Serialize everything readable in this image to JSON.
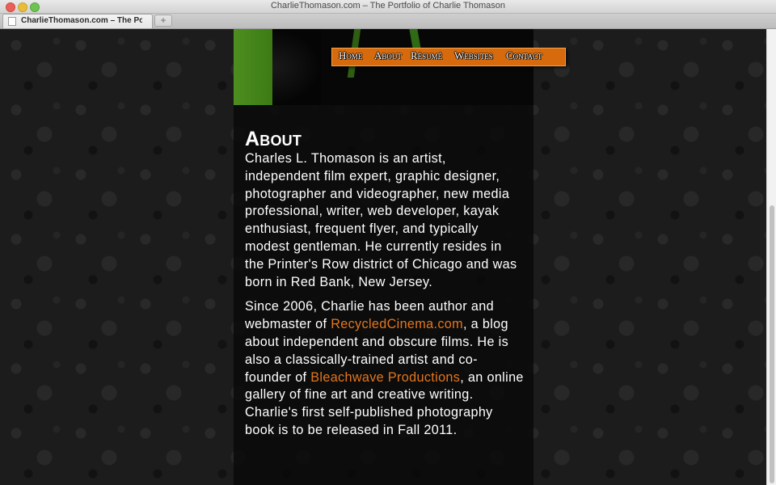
{
  "window": {
    "title": "CharlieThomason.com – The Portfolio of Charlie Thomason",
    "tab_label": "CharlieThomason.com – The Po…",
    "new_tab": "+"
  },
  "nav": {
    "home": "Home",
    "about": "About",
    "resume": "Résumé",
    "websites": "Websites",
    "contact": "Contact"
  },
  "page": {
    "heading": "About",
    "para1": "Charles L. Thomason is an artist, independent film expert, graphic designer, photographer and videographer, new media professional, writer, web developer, kayak enthusiast, frequent flyer, and typically modest gentleman. He currently resides in the Printer's Row district of Chicago and was born in Red Bank, New Jersey.",
    "para2_a": "Since 2006, Charlie has been author and webmaster of ",
    "para2_link1": "RecycledCinema.com",
    "para2_b": ", a blog about independent and obscure films. He is also a classically-trained artist and co-founder of ",
    "para2_link2": "Bleachwave Productions",
    "para2_c": ", an online gallery of fine art and creative writing. Charlie's first self-published photography book is to be released in Fall 2011."
  },
  "colors": {
    "nav_bg": "#d66a0c",
    "link": "#e4761d",
    "header_green": "#4c8e1e"
  }
}
